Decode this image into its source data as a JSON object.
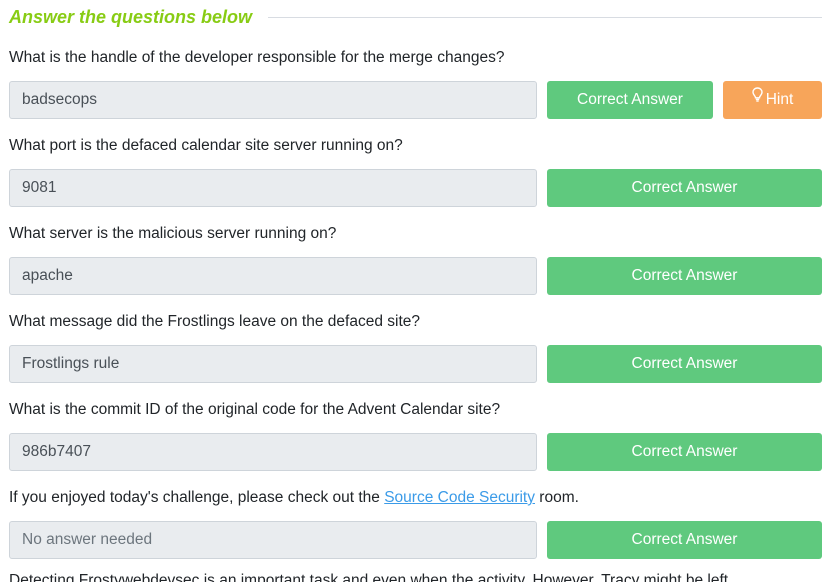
{
  "section": {
    "title": "Answer the questions below"
  },
  "questions": [
    {
      "text": "What is the handle of the developer responsible for the merge changes?",
      "answer": "badsecops",
      "button": "Correct Answer",
      "hint": "Hint"
    },
    {
      "text": "What port is the defaced calendar site server running on?",
      "answer": "9081",
      "button": "Correct Answer"
    },
    {
      "text": "What server is the malicious server running on?",
      "answer": "apache",
      "button": "Correct Answer"
    },
    {
      "text": "What message did the Frostlings leave on the defaced site?",
      "answer": "Frostlings rule",
      "button": "Correct Answer"
    },
    {
      "text": "What is the commit ID of the original code for the Advent Calendar site?",
      "answer": "986b7407",
      "button": "Correct Answer"
    },
    {
      "text_before": "If you enjoyed today's challenge, please check out the ",
      "link": "Source Code Security",
      "text_after": " room.",
      "answer": "No answer needed",
      "button": "Correct Answer"
    }
  ],
  "partial_question": {
    "text": "Detecting Frostywebdevsec is an important task and even when the activity. However, Tracy might be left..."
  },
  "colors": {
    "accent_green": "#88cc14",
    "correct_button": "#5fc97e",
    "hint_button": "#f7a55a",
    "link": "#3b9be8"
  },
  "icons": {
    "hint": "lightbulb-icon"
  }
}
